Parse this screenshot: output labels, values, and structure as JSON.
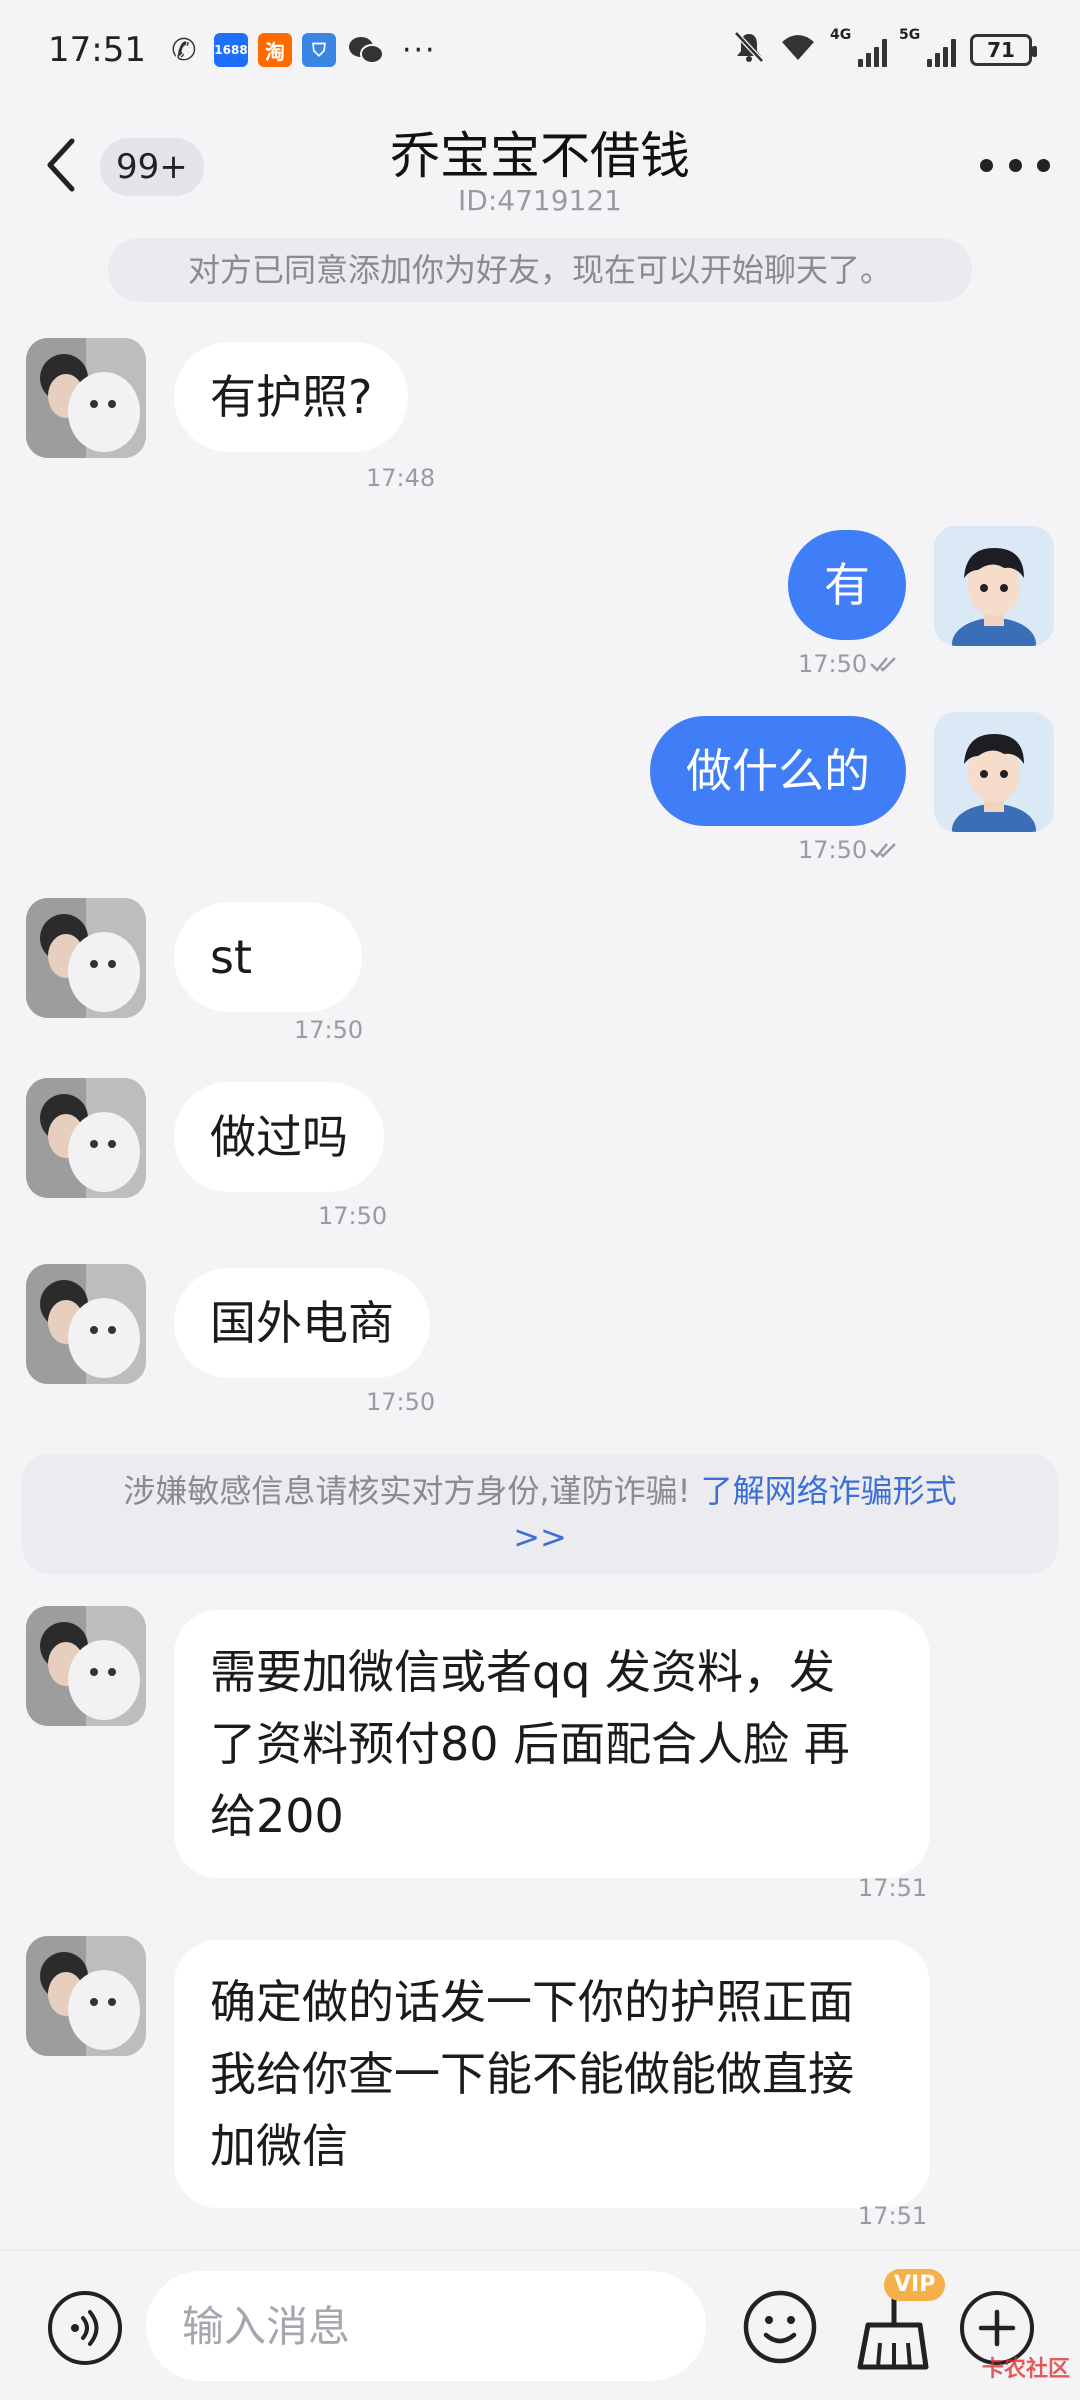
{
  "status_bar": {
    "time": "17:51",
    "battery": "71",
    "network_1": "4G",
    "network_2": "5G",
    "app_icons": [
      "missed-call-icon",
      "1688-icon",
      "taobao-icon",
      "shield-app-icon",
      "wechat-icon"
    ],
    "app_1688_label": "1688",
    "app_taobao_label": "淘",
    "more_indicator": "···"
  },
  "header": {
    "unread_badge": "99+",
    "title": "乔宝宝不借钱",
    "user_id": "ID:4719121"
  },
  "system_notice": "对方已同意添加你为好友，现在可以开始聊天了。",
  "messages": [
    {
      "direction": "in",
      "text": "有护照?",
      "time": "17:48"
    },
    {
      "direction": "out",
      "text": "有",
      "time": "17:50",
      "read": true
    },
    {
      "direction": "out",
      "text": "做什么的",
      "time": "17:50",
      "read": true
    },
    {
      "direction": "in",
      "text": "st",
      "time": "17:50"
    },
    {
      "direction": "in",
      "text": "做过吗",
      "time": "17:50"
    },
    {
      "direction": "in",
      "text": "国外电商",
      "time": "17:50"
    },
    {
      "direction": "in",
      "lines": [
        "需要加微信或者qq  发资料，发",
        "了资料预付80 后面配合人脸 再",
        "给200"
      ],
      "time": "17:51"
    },
    {
      "direction": "in",
      "lines": [
        "确定做的话发一下你的护照正面",
        "我给你查一下能不能做能做直接",
        "加微信"
      ],
      "time": "17:51"
    }
  ],
  "warning": {
    "text": "涉嫌敏感信息请核实对方身份,谨防诈骗!",
    "link": "了解网络诈骗形式",
    "link_suffix": ">>"
  },
  "input_bar": {
    "placeholder": "输入消息",
    "vip_label": "VIP"
  },
  "colors": {
    "accent": "#3f7ef6",
    "background": "#f4f4f7",
    "link": "#3b6fd8",
    "vip": "#f5b04a"
  },
  "watermark": "卡农社区"
}
